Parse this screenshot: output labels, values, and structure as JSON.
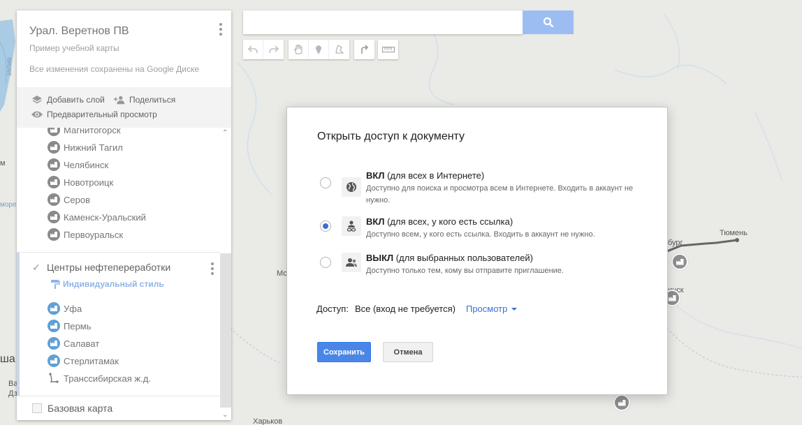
{
  "panel": {
    "title": "Урал. Веретнов ПВ",
    "description": "Пример учебной карты",
    "saved_status": "Все изменения сохранены на Google Диске",
    "add_layer": "Добавить слой",
    "share": "Поделиться",
    "preview": "Предварительный просмотр",
    "layer1_items": [
      {
        "label": "Магнитогорск",
        "icon": "factory-icon"
      },
      {
        "label": "Нижний Тагил",
        "icon": "factory-icon"
      },
      {
        "label": "Челябинск",
        "icon": "factory-icon"
      },
      {
        "label": "Новотроицк",
        "icon": "factory-icon"
      },
      {
        "label": "Серов",
        "icon": "factory-icon"
      },
      {
        "label": "Каменск-Уральский",
        "icon": "factory-icon"
      },
      {
        "label": "Первоуральск",
        "icon": "factory-icon"
      }
    ],
    "layer2": {
      "title": "Центры нефтепереработки",
      "style_link": "Индивидуальный стиль",
      "items": [
        {
          "label": "Уфа",
          "icon": "factory-icon"
        },
        {
          "label": "Пермь",
          "icon": "factory-icon"
        },
        {
          "label": "Салават",
          "icon": "factory-icon"
        },
        {
          "label": "Стерлитамак",
          "icon": "factory-icon"
        },
        {
          "label": "Транссибирская ж.д.",
          "icon": "line-icon"
        }
      ]
    },
    "base_map": "Базовая карта"
  },
  "search": {
    "value": "",
    "placeholder": ""
  },
  "map_labels": {
    "tyumen": "Тюмень",
    "burg": "бург",
    "insk": "инск",
    "mo": "Мо",
    "more": "море",
    "zaliv": "залив",
    "m": "м",
    "sha": "ша",
    "ba": "Ba",
    "dze": "Дз",
    "kharkiv": "Харьков"
  },
  "dialog": {
    "title": "Открыть доступ к документу",
    "options": [
      {
        "title_strong": "ВКЛ",
        "title_rest": " (для всех в Интернете)",
        "description": "Доступно для поиска и просмотра всем в Интернете. Входить в аккаунт не нужно.",
        "icon": "globe-icon",
        "selected": false
      },
      {
        "title_strong": "ВКЛ",
        "title_rest": " (для всех, у кого есть ссылка)",
        "description": "Доступно всем, у кого есть ссылка. Входить в аккаунт не нужно.",
        "icon": "link-person-icon",
        "selected": true
      },
      {
        "title_strong": "ВЫКЛ",
        "title_rest": " (для выбранных пользователей)",
        "description": "Доступно только тем, кому вы отправите приглашение.",
        "icon": "people-icon",
        "selected": false
      }
    ],
    "access_label": "Доступ:",
    "access_value": "Все (вход не требуется)",
    "access_mode": "Просмотр",
    "save_label": "Сохранить",
    "cancel_label": "Отмена"
  },
  "colors": {
    "accent": "#4a86e8",
    "link": "#3c6fd1",
    "map_bg": "#eaeae6",
    "water": "#a9cbe4",
    "route": "#666666"
  }
}
